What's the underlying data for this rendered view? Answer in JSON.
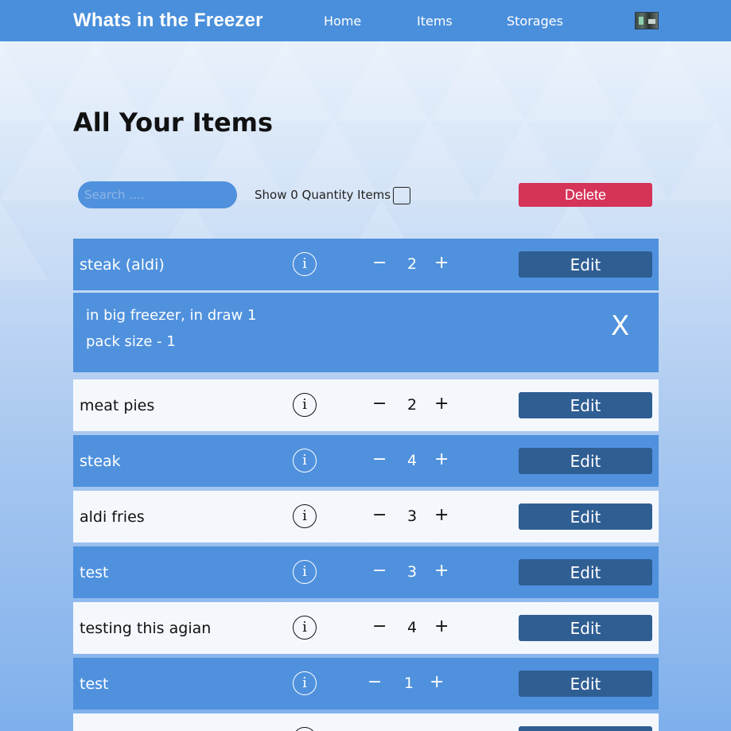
{
  "navbar": {
    "brand": "Whats in the Freezer",
    "links": [
      "Home",
      "Items",
      "Storages"
    ]
  },
  "page": {
    "title": "All Your Items"
  },
  "toolbar": {
    "search_placeholder": "Search ....",
    "show_zero_label": "Show 0 Quantity Items",
    "show_zero_checked": false,
    "delete_label": "Delete"
  },
  "items": [
    {
      "name": "steak (aldi)",
      "qty": "2",
      "edit": "Edit",
      "info": "i",
      "minus": "−",
      "plus": "+"
    },
    {
      "name": "meat pies",
      "qty": "2",
      "edit": "Edit",
      "info": "i",
      "minus": "−",
      "plus": "+"
    },
    {
      "name": "steak",
      "qty": "4",
      "edit": "Edit",
      "info": "i",
      "minus": "−",
      "plus": "+"
    },
    {
      "name": "aldi fries",
      "qty": "3",
      "edit": "Edit",
      "info": "i",
      "minus": "−",
      "plus": "+"
    },
    {
      "name": "test",
      "qty": "3",
      "edit": "Edit",
      "info": "i",
      "minus": "−",
      "plus": "+"
    },
    {
      "name": "testing this agian",
      "qty": "4",
      "edit": "Edit",
      "info": "i",
      "minus": "−",
      "plus": "+"
    },
    {
      "name": "test",
      "qty": "1",
      "edit": "Edit",
      "info": "i",
      "minus": "−",
      "plus": "+"
    },
    {
      "name": "",
      "qty": "",
      "edit": "",
      "info": "i",
      "minus": "",
      "plus": ""
    }
  ],
  "detail": {
    "location": "in big freezer, in draw 1",
    "pack_size": "pack size - 1",
    "close": "X"
  },
  "colors": {
    "navbar": "#4a8fdb",
    "row_blue": "#4f91dd",
    "row_white": "#f4f8fd",
    "edit_button": "#2f5e93",
    "delete_button": "#d63358"
  }
}
